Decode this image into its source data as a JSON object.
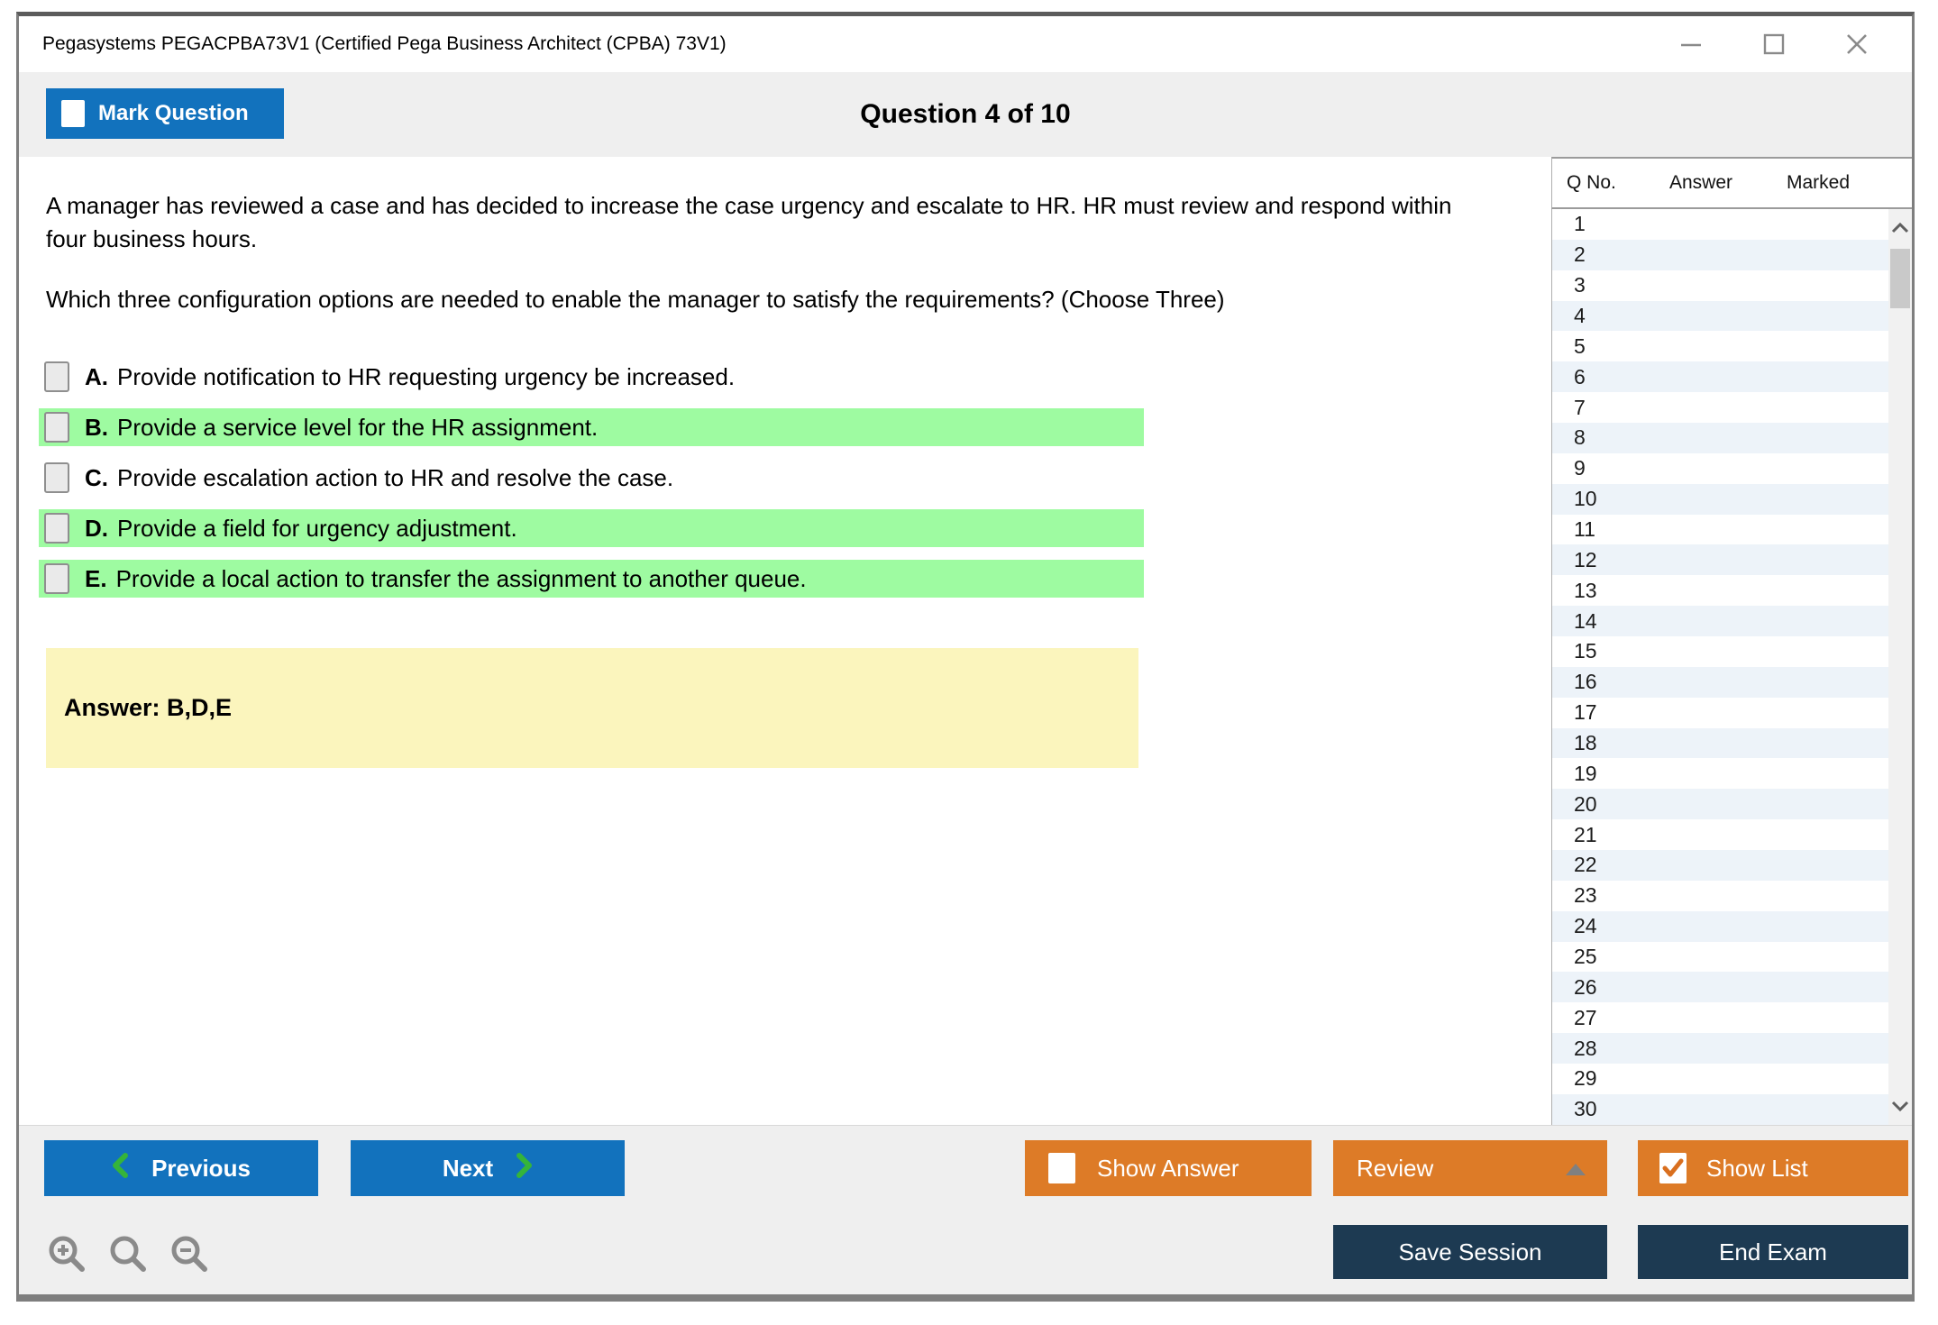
{
  "window": {
    "title": "Pegasystems PEGACPBA73V1 (Certified Pega Business Architect (CPBA) 73V1)"
  },
  "header": {
    "mark_question_label": "Mark Question",
    "question_counter": "Question 4 of 10"
  },
  "question": {
    "paragraphs": [
      "A manager has reviewed a case and has decided to increase the case urgency and escalate to HR. HR must review and respond within four business hours.",
      "Which three configuration options are needed to enable the manager to satisfy the requirements? (Choose Three)"
    ],
    "options": [
      {
        "letter": "A.",
        "text": "Provide notification to HR requesting urgency be increased.",
        "highlighted": false
      },
      {
        "letter": "B.",
        "text": "Provide a service level for the HR assignment.",
        "highlighted": true
      },
      {
        "letter": "C.",
        "text": "Provide escalation action to HR and resolve the case.",
        "highlighted": false
      },
      {
        "letter": "D.",
        "text": "Provide a field for urgency adjustment.",
        "highlighted": true
      },
      {
        "letter": "E.",
        "text": "Provide a local action to transfer the assignment to another queue.",
        "highlighted": true
      }
    ],
    "answer_label": "Answer: B,D,E"
  },
  "sidebar": {
    "columns": {
      "qno": "Q No.",
      "answer": "Answer",
      "marked": "Marked"
    },
    "rows": [
      {
        "q": "1",
        "answer": "",
        "marked": ""
      },
      {
        "q": "2",
        "answer": "",
        "marked": ""
      },
      {
        "q": "3",
        "answer": "",
        "marked": ""
      },
      {
        "q": "4",
        "answer": "",
        "marked": ""
      },
      {
        "q": "5",
        "answer": "",
        "marked": ""
      },
      {
        "q": "6",
        "answer": "",
        "marked": ""
      },
      {
        "q": "7",
        "answer": "",
        "marked": ""
      },
      {
        "q": "8",
        "answer": "",
        "marked": ""
      },
      {
        "q": "9",
        "answer": "",
        "marked": ""
      },
      {
        "q": "10",
        "answer": "",
        "marked": ""
      },
      {
        "q": "11",
        "answer": "",
        "marked": ""
      },
      {
        "q": "12",
        "answer": "",
        "marked": ""
      },
      {
        "q": "13",
        "answer": "",
        "marked": ""
      },
      {
        "q": "14",
        "answer": "",
        "marked": ""
      },
      {
        "q": "15",
        "answer": "",
        "marked": ""
      },
      {
        "q": "16",
        "answer": "",
        "marked": ""
      },
      {
        "q": "17",
        "answer": "",
        "marked": ""
      },
      {
        "q": "18",
        "answer": "",
        "marked": ""
      },
      {
        "q": "19",
        "answer": "",
        "marked": ""
      },
      {
        "q": "20",
        "answer": "",
        "marked": ""
      },
      {
        "q": "21",
        "answer": "",
        "marked": ""
      },
      {
        "q": "22",
        "answer": "",
        "marked": ""
      },
      {
        "q": "23",
        "answer": "",
        "marked": ""
      },
      {
        "q": "24",
        "answer": "",
        "marked": ""
      },
      {
        "q": "25",
        "answer": "",
        "marked": ""
      },
      {
        "q": "26",
        "answer": "",
        "marked": ""
      },
      {
        "q": "27",
        "answer": "",
        "marked": ""
      },
      {
        "q": "28",
        "answer": "",
        "marked": ""
      },
      {
        "q": "29",
        "answer": "",
        "marked": ""
      },
      {
        "q": "30",
        "answer": "",
        "marked": ""
      }
    ]
  },
  "footer": {
    "previous_label": "Previous",
    "next_label": "Next",
    "show_answer_label": "Show Answer",
    "review_label": "Review",
    "show_list_label": "Show List",
    "save_session_label": "Save Session",
    "end_exam_label": "End Exam"
  },
  "colors": {
    "accent_blue": "#1272bd",
    "accent_orange": "#dd7b27",
    "accent_navy": "#1d3a52",
    "highlight_green": "#9efba1",
    "answer_yellow": "#fbf5bd",
    "strip_gray": "#efefef",
    "row_alt_blue": "#edf3f9"
  }
}
